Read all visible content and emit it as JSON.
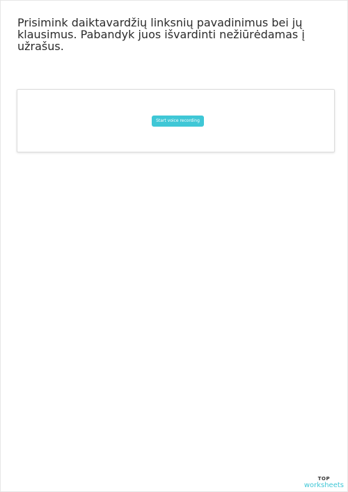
{
  "instruction": {
    "text": "Prisimink daiktavardžių linksnių pavadinimus bei jų klausimus. Pabandyk juos išvardinti nežiūrėdamas į užrašus."
  },
  "recorder": {
    "button_label": "Start voice recording"
  },
  "brand": {
    "top": "TOP",
    "bottom": "worksheets"
  },
  "colors": {
    "accent": "#3fc7d6",
    "text": "#2b2b2b"
  }
}
